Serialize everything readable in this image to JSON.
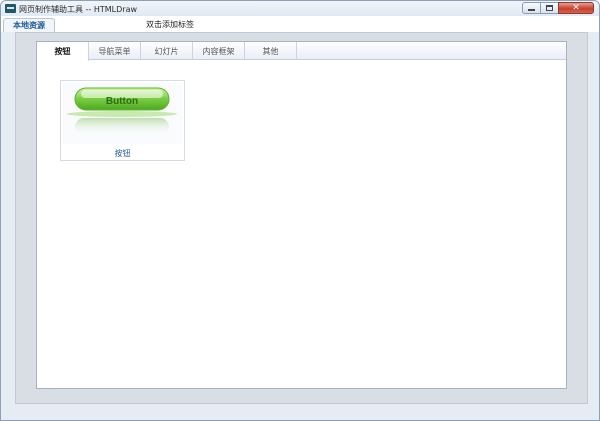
{
  "window": {
    "title": "网页制作辅助工具 -- HTMLDraw",
    "close_glyph": "✕"
  },
  "top_tabs": {
    "active": "本地资源",
    "add_hint": "双击添加标签"
  },
  "sub_tabs": [
    "按钮",
    "导航菜单",
    "幻灯片",
    "内容框架",
    "其他"
  ],
  "items": [
    {
      "label": "按钮",
      "preview_text": "Button"
    }
  ],
  "colors": {
    "accent_link": "#1d5a96",
    "button_green": "#6cc43a"
  }
}
